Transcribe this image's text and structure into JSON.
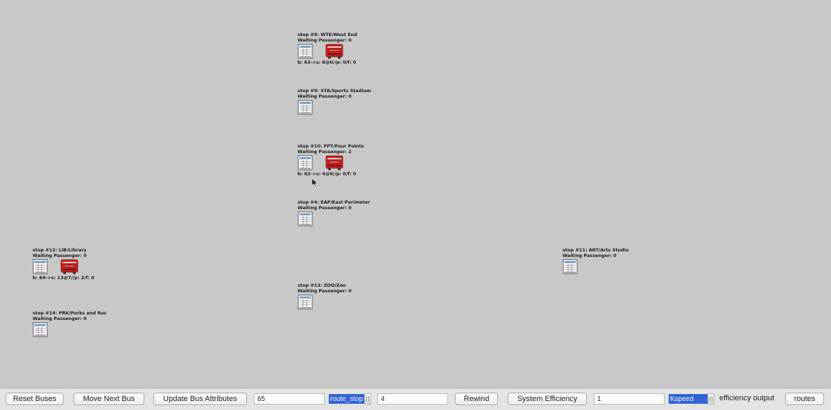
{
  "stops": [
    {
      "title": "stop #8: WTE/West End",
      "waiting": "Waiting Passenger: 0",
      "has_bus": true,
      "bus_info": "b: 63->s: 8@0//p: 0/f: 0"
    },
    {
      "title": "stop #9: STA/Sports Stadium",
      "waiting": "Waiting Passenger: 0",
      "has_bus": false,
      "bus_info": ""
    },
    {
      "title": "stop #10: FPT/Four Points",
      "waiting": "Waiting Passenger: 2",
      "has_bus": true,
      "bus_info": "b: 62->s: 4@6//p: 0/f: 0"
    },
    {
      "title": "stop #4: EAP/East Perimeter",
      "waiting": "Waiting Passenger: 0",
      "has_bus": false,
      "bus_info": ""
    },
    {
      "title": "stop #12: LIB/Library",
      "waiting": "Waiting Passenger: 0",
      "has_bus": true,
      "bus_info": "b: 64->s: 13@7//p: 2/f: 0"
    },
    {
      "title": "stop #11: ART/Arts Studio",
      "waiting": "Waiting Passenger: 0",
      "has_bus": false,
      "bus_info": ""
    },
    {
      "title": "stop #13: ZOO/Zoo",
      "waiting": "Waiting Passenger: 0",
      "has_bus": false,
      "bus_info": ""
    },
    {
      "title": "stop #14: PRK/Parks and Rec",
      "waiting": "Waiting Passenger: 0",
      "has_bus": false,
      "bus_info": ""
    }
  ],
  "toolbar": {
    "reset_buses": "Reset Buses",
    "move_next_bus": "Move Next Bus",
    "update_bus_attributes": "Update Bus Attributes",
    "bus_field_value": "65",
    "attribute_select": "route_stop",
    "attribute_value": "4",
    "rewind": "Rewind",
    "system_efficiency": "System Efficiency",
    "efficiency_field_value": "1",
    "constant_select": "Kspeed",
    "efficiency_output_label": "efficiency output",
    "routes": "routes"
  },
  "colors": {
    "canvas_bg": "#c8c8c8",
    "bus_red": "#c8201e",
    "select_highlight": "#2f63d6"
  }
}
